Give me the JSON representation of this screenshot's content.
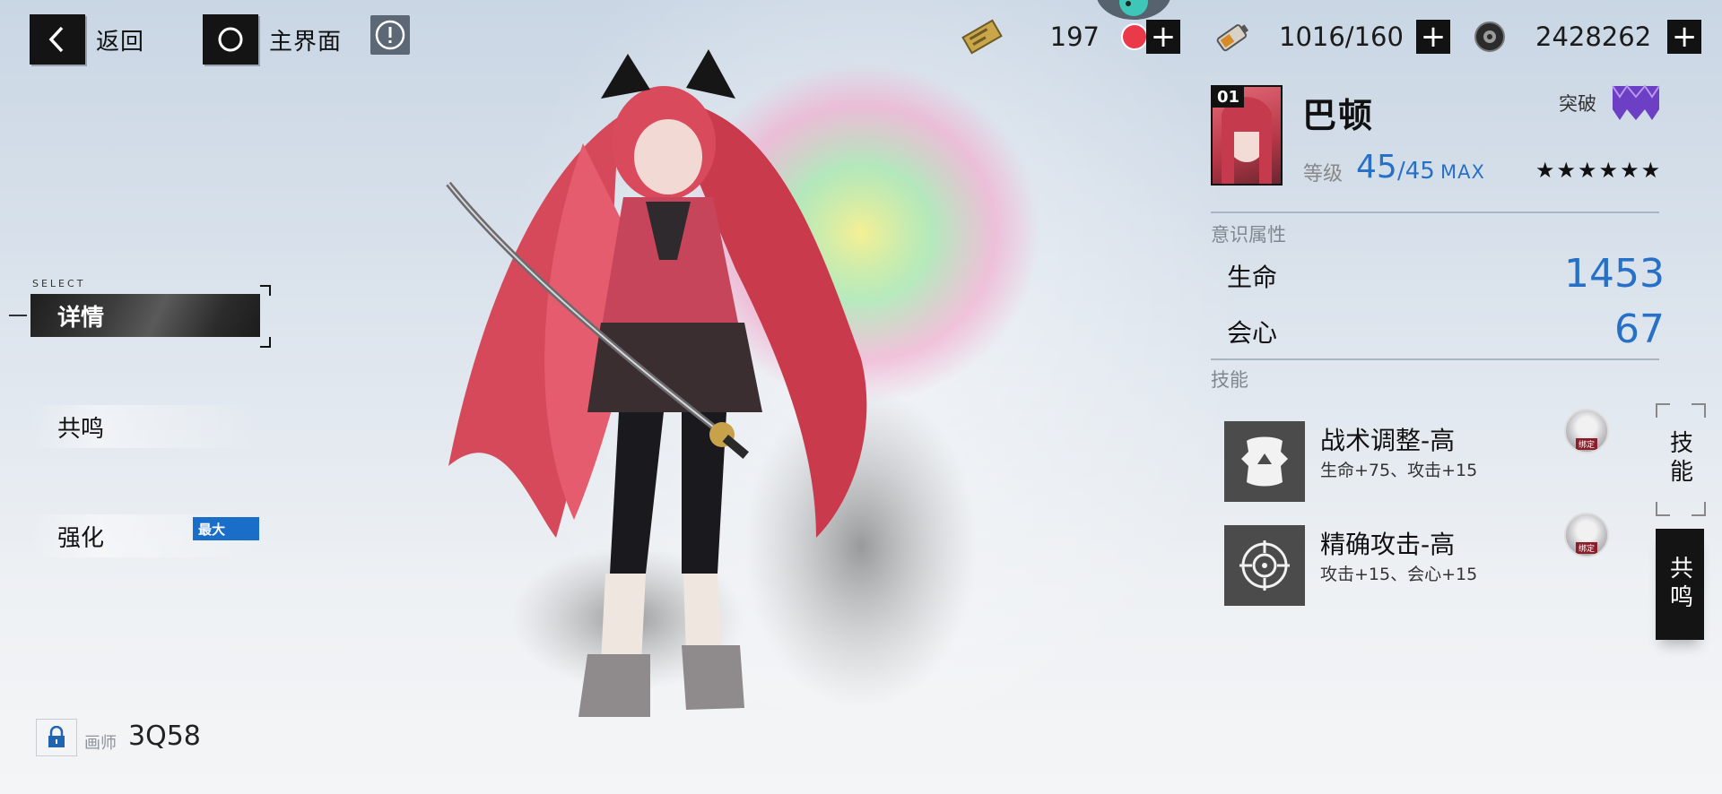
{
  "colors": {
    "accent": "#2671c7",
    "dark": "#141414",
    "max_badge": "#1a6ec8",
    "notify": "#ea3a4a"
  },
  "nav": {
    "back_label": "返回",
    "home_label": "主界面"
  },
  "resources": [
    {
      "icon": "ticket-icon",
      "value": "197"
    },
    {
      "icon": "battery-icon",
      "value": "1016/160"
    },
    {
      "icon": "gear-coin-icon",
      "value": "2428262"
    }
  ],
  "menu": {
    "select_hint": "SELECT",
    "items": [
      {
        "label": "详情",
        "active": true
      },
      {
        "label": "共鸣",
        "active": false
      },
      {
        "label": "强化",
        "active": false,
        "badge": "最大"
      }
    ]
  },
  "artist": {
    "label": "画师",
    "name": "3Q58"
  },
  "character": {
    "slot": "01",
    "name": "巴顿",
    "breakthrough_label": "突破",
    "level_label": "等级",
    "level": "45",
    "level_max": "/45",
    "max_tag": "MAX",
    "stars": "★★★★★★"
  },
  "attributes": {
    "title": "意识属性",
    "hp_label": "生命",
    "hp_value": "1453",
    "crit_label": "会心",
    "crit_value": "67"
  },
  "skills": {
    "title": "技能",
    "list": [
      {
        "name": "战术调整-高",
        "desc": "生命+75、攻击+15",
        "bind_tag": "绑定"
      },
      {
        "name": "精确攻击-高",
        "desc": "攻击+15、会心+15",
        "bind_tag": "绑定"
      }
    ]
  },
  "side_tabs": {
    "skill": "技能",
    "resonance": "共鸣"
  }
}
